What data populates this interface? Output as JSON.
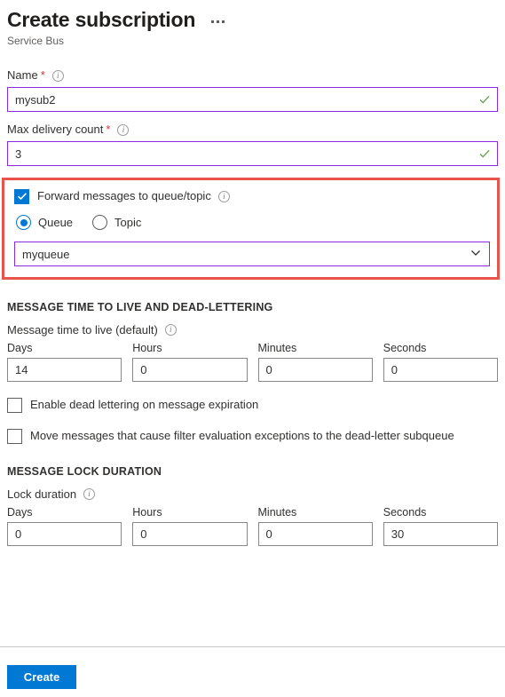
{
  "header": {
    "title": "Create subscription",
    "subtitle": "Service Bus",
    "more_menu": "···"
  },
  "form": {
    "name": {
      "label": "Name",
      "required_mark": "*",
      "value": "mysub2",
      "valid_icon": "check-icon"
    },
    "max_delivery_count": {
      "label": "Max delivery count",
      "required_mark": "*",
      "value": "3",
      "valid_icon": "check-icon"
    },
    "forward": {
      "checkbox_label": "Forward messages to queue/topic",
      "checked": true,
      "radios": [
        {
          "label": "Queue",
          "selected": true
        },
        {
          "label": "Topic",
          "selected": false
        }
      ],
      "dropdown_value": "myqueue"
    },
    "ttl_section": {
      "heading": "MESSAGE TIME TO LIVE AND DEAD-LETTERING",
      "sub_label": "Message time to live (default)",
      "fields": [
        {
          "label": "Days",
          "value": "14"
        },
        {
          "label": "Hours",
          "value": "0"
        },
        {
          "label": "Minutes",
          "value": "0"
        },
        {
          "label": "Seconds",
          "value": "0"
        }
      ],
      "checkboxes": [
        {
          "label": "Enable dead lettering on message expiration",
          "checked": false
        },
        {
          "label": "Move messages that cause filter evaluation exceptions to the dead-letter subqueue",
          "checked": false
        }
      ]
    },
    "lock_section": {
      "heading": "MESSAGE LOCK DURATION",
      "sub_label": "Lock duration",
      "fields": [
        {
          "label": "Days",
          "value": "0"
        },
        {
          "label": "Hours",
          "value": "0"
        },
        {
          "label": "Minutes",
          "value": "0"
        },
        {
          "label": "Seconds",
          "value": "30"
        }
      ]
    }
  },
  "footer": {
    "create_label": "Create"
  },
  "colors": {
    "accent_blue": "#0078d4",
    "highlight_red": "#e8544b",
    "focus_purple": "#8a2be2",
    "valid_green": "#6aa84f",
    "required_red": "#d13438"
  }
}
